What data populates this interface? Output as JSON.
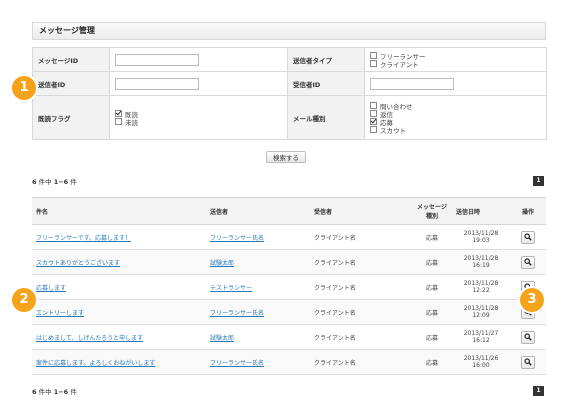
{
  "header": {
    "title": "メッセージ管理"
  },
  "search": {
    "message_id_label": "メッセージID",
    "sender_type_label": "送信者タイプ",
    "sender_types": [
      {
        "label": "フリーランサー",
        "checked": false
      },
      {
        "label": "クライアント",
        "checked": false
      }
    ],
    "sender_id_label": "送信者ID",
    "receiver_id_label": "受信者ID",
    "read_flag_label": "既読フラグ",
    "read_flags": [
      {
        "label": "既読",
        "checked": true
      },
      {
        "label": "未読",
        "checked": false
      }
    ],
    "mail_type_label": "メール種別",
    "mail_types": [
      {
        "label": "問い合わせ",
        "checked": false
      },
      {
        "label": "返信",
        "checked": false
      },
      {
        "label": "応募",
        "checked": true
      },
      {
        "label": "スカウト",
        "checked": false
      }
    ],
    "submit_label": "検索する"
  },
  "summary": {
    "total": "6",
    "total_suffix": "件中",
    "range": "1−6",
    "range_suffix": "件",
    "page": "1"
  },
  "table": {
    "headers": [
      "件名",
      "送信者",
      "受信者",
      "メッセージ\n種別",
      "送信日時",
      "操作"
    ],
    "rows": [
      {
        "subject": "フリーランサーです。応募します！",
        "sender": "フリーランサー氏名",
        "receiver": "クライアント名",
        "type": "応募",
        "date": "2013/11/28",
        "time": "19:03"
      },
      {
        "subject": "スカウトありがとうございます",
        "sender": "試験太郎",
        "receiver": "クライアント名",
        "type": "応募",
        "date": "2013/11/28",
        "time": "16:19"
      },
      {
        "subject": "応募します",
        "sender": "テストランサー",
        "receiver": "クライアント名",
        "type": "応募",
        "date": "2013/11/28",
        "time": "12:22"
      },
      {
        "subject": "エントリーします",
        "sender": "フリーランサー氏名",
        "receiver": "クライアント名",
        "type": "応募",
        "date": "2013/11/28",
        "time": "12:09"
      },
      {
        "subject": "はじめまして、しげんたろうと申します",
        "sender": "試験太郎",
        "receiver": "クライアント名",
        "type": "応募",
        "date": "2013/11/27",
        "time": "16:12"
      },
      {
        "subject": "案件に応募します。よろしくおねがいします",
        "sender": "フリーランサー氏名",
        "receiver": "クライアント名",
        "type": "応募",
        "date": "2013/11/26",
        "time": "16:00"
      }
    ]
  },
  "badges": [
    "1",
    "2",
    "3"
  ],
  "colors": {
    "badge": "#f5a31a",
    "link": "#2a7ab8"
  },
  "icons": {
    "action": "magnifier-icon"
  }
}
